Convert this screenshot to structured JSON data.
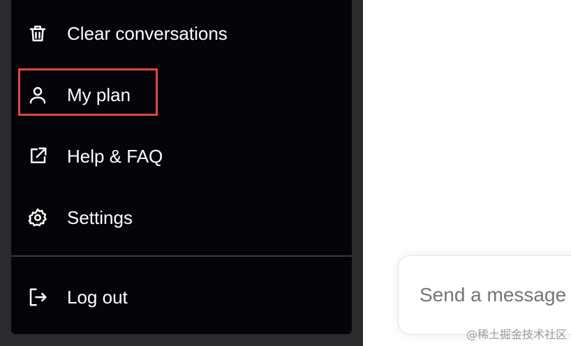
{
  "menu": {
    "items": [
      {
        "id": "clear",
        "label": "Clear conversations",
        "icon": "trash-icon"
      },
      {
        "id": "plan",
        "label": "My plan",
        "icon": "user-icon"
      },
      {
        "id": "help",
        "label": "Help & FAQ",
        "icon": "external-link-icon"
      },
      {
        "id": "settings",
        "label": "Settings",
        "icon": "gear-icon"
      }
    ],
    "logout": {
      "label": "Log out",
      "icon": "logout-icon"
    }
  },
  "composer": {
    "placeholder": "Send a message"
  },
  "watermark": "@稀土掘金技术社区",
  "colors": {
    "menu_bg": "#050509",
    "sidebar_bg": "#2b2b2e",
    "highlight": "#e2493a"
  }
}
